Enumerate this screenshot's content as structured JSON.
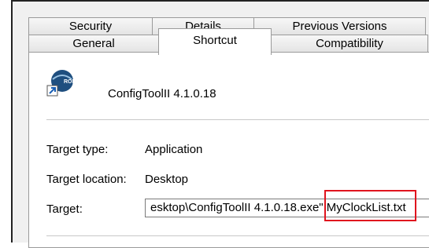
{
  "tabs_row1": [
    "Security",
    "Details",
    "Previous Versions"
  ],
  "tabs_row2": [
    "General",
    "Shortcut",
    "Compatibility"
  ],
  "active_tab": "Shortcut",
  "app": {
    "name": "ConfigToolII 4.1.0.18",
    "icon": "shortcut-app-icon"
  },
  "fields": {
    "target_type_label": "Target type:",
    "target_type_value": "Application",
    "target_location_label": "Target location:",
    "target_location_value": "Desktop",
    "target_label": "Target:",
    "target_value_visible": "esktop\\ConfigToolII 4.1.0.18.exe\" MyClockList.txt"
  },
  "colors": {
    "highlight": "#e0141e",
    "icon_blue": "#1f4f7f"
  }
}
